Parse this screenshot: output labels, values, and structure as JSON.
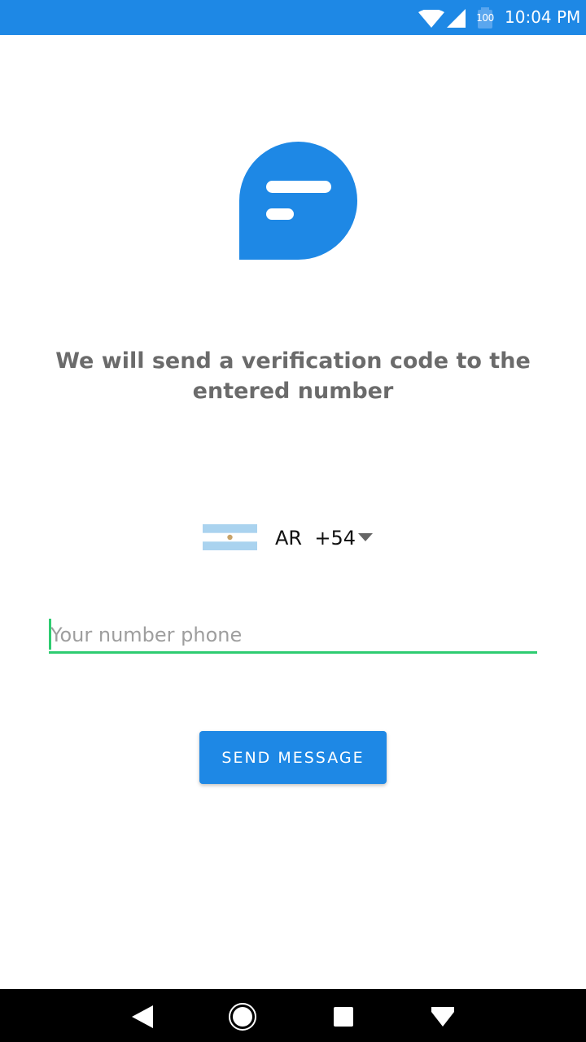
{
  "status_bar": {
    "battery_level": "100",
    "time": "10:04 PM",
    "icons": [
      "wifi-icon",
      "signal-icon",
      "battery-icon"
    ]
  },
  "logo": {
    "icon": "chat-bubble-icon",
    "color": "#1e88e5"
  },
  "instruction": "We will send a verification code to the entered number",
  "country_select": {
    "flag": "argentina-flag-icon",
    "code": "AR  +54",
    "icon": "dropdown-caret-icon"
  },
  "phone_input": {
    "placeholder": "Your number phone",
    "value": "",
    "accent_color": "#2ecc71"
  },
  "send_button": {
    "label": "SEND MESSAGE",
    "color": "#1e88e5"
  },
  "nav_bar": {
    "buttons": [
      "back-icon",
      "home-icon",
      "recents-icon",
      "notifications-icon"
    ]
  }
}
